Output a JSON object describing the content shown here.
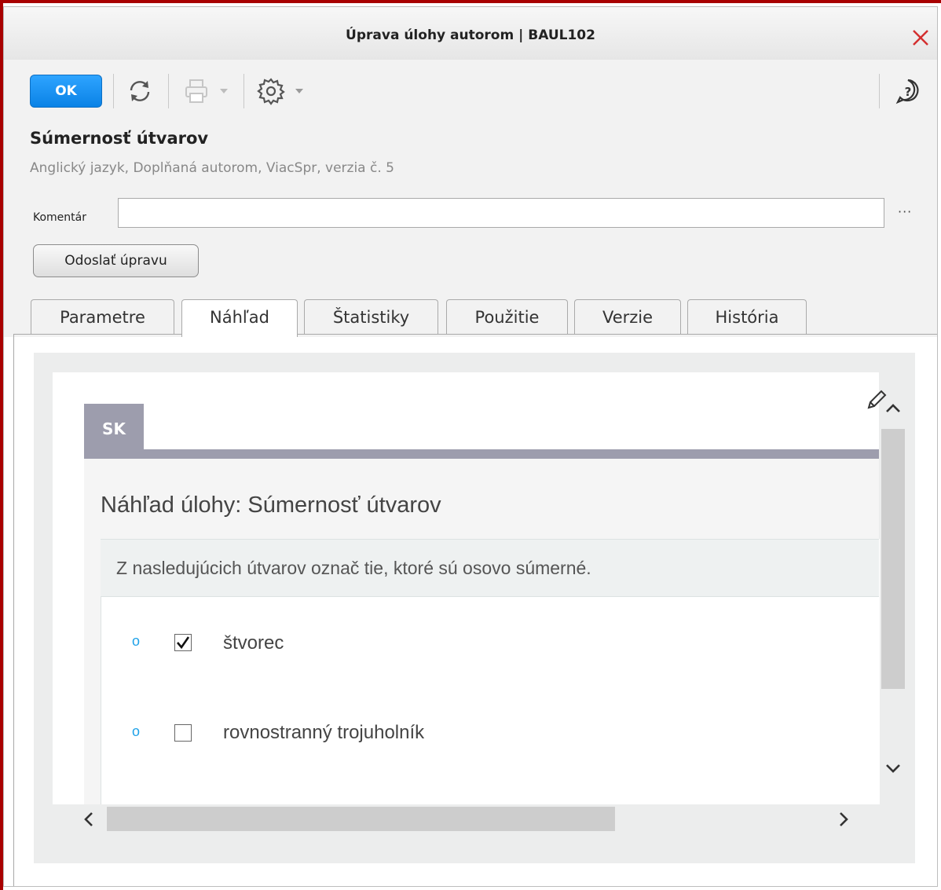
{
  "window": {
    "title": "Úprava úlohy autorom | BAUL102"
  },
  "toolbar": {
    "ok_label": "OK",
    "icons": [
      "refresh-icon",
      "print-icon",
      "settings-icon",
      "help-icon"
    ]
  },
  "task": {
    "title": "Súmernosť útvarov",
    "subtitle": "Anglický jazyk, Doplňaná autorom, ViacSpr, verzia č. 5"
  },
  "comment": {
    "label": "Komentár",
    "value": "",
    "more_label": "···"
  },
  "send_button_label": "Odoslať úpravu",
  "tabs": [
    {
      "label": "Parametre",
      "active": false
    },
    {
      "label": "Náhľad",
      "active": true
    },
    {
      "label": "Štatistiky",
      "active": false
    },
    {
      "label": "Použitie",
      "active": false
    },
    {
      "label": "Verzie",
      "active": false
    },
    {
      "label": "História",
      "active": false
    }
  ],
  "preview": {
    "lang_tab": "SK",
    "title": "Náhľad úlohy: Súmernosť útvarov",
    "question": "Z nasledujúcich útvarov označ tie, ktoré sú osovo súmerné.",
    "options": [
      {
        "marker": "o",
        "label": "štvorec",
        "checked": true
      },
      {
        "marker": "o",
        "label": "rovnostranný trojuholník",
        "checked": false
      }
    ]
  },
  "colors": {
    "accent": "#0a82e6",
    "frame": "#a80000",
    "lang_tab": "#9d9dad",
    "option_marker": "#1ea1e8"
  }
}
